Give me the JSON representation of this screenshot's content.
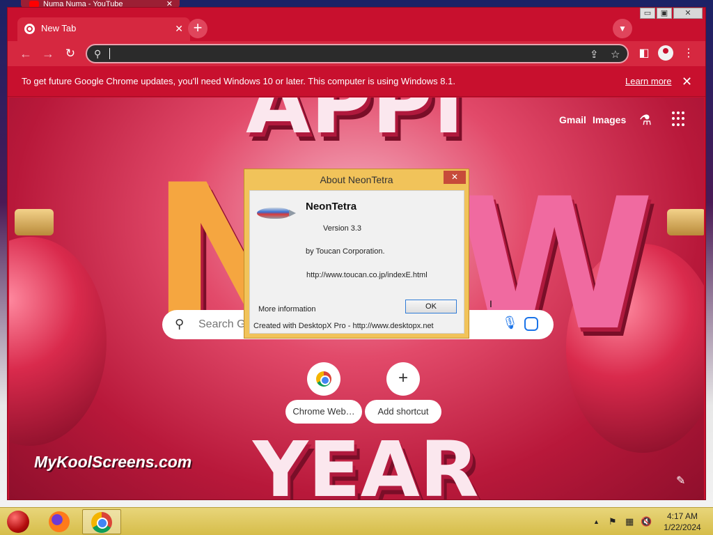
{
  "background_window": {
    "tab_title": "Numa Numa - YouTube"
  },
  "browser": {
    "tab": {
      "title": "New Tab",
      "close_glyph": "✕"
    },
    "new_tab_glyph": "+",
    "window_controls": {
      "minimize": "▭",
      "maximize": "▣",
      "close": "✕"
    },
    "toolbar": {
      "back": "←",
      "forward": "→",
      "reload": "↻",
      "address_value": ""
    },
    "infobar": {
      "message": "To get future Google Chrome updates, you'll need Windows 10 or later. This computer is using Windows 8.1.",
      "learn_more": "Learn more",
      "close_glyph": "✕"
    }
  },
  "ntp": {
    "links": {
      "gmail": "Gmail",
      "images": "Images"
    },
    "search_placeholder": "Search Google or type a URL",
    "shortcuts": [
      {
        "label": "Chrome Web…"
      },
      {
        "label": "Add shortcut",
        "glyph": "+"
      }
    ],
    "watermark": "MyKoolScreens.com",
    "edit_glyph": "✎"
  },
  "dialog": {
    "title": "About NeonTetra",
    "close_glyph": "✕",
    "app_name": "NeonTetra",
    "version": "Version 3.3",
    "author": "by Toucan Corporation.",
    "url": "http://www.toucan.co.jp/indexE.html",
    "more_info": "More information",
    "ok_label": "OK",
    "footer": "Created with DesktopX Pro -  http://www.desktopx.net"
  },
  "taskbar": {
    "tray_arrow": "▲",
    "tray_flag": "⚑",
    "tray_network": "▦",
    "tray_volume": "🔇",
    "time": "4:17 AM",
    "date": "1/22/2024"
  },
  "colors": {
    "chrome_theme": "#c8102e",
    "dialog_frame": "#f1c35a",
    "taskbar": "#d6bd4a"
  }
}
